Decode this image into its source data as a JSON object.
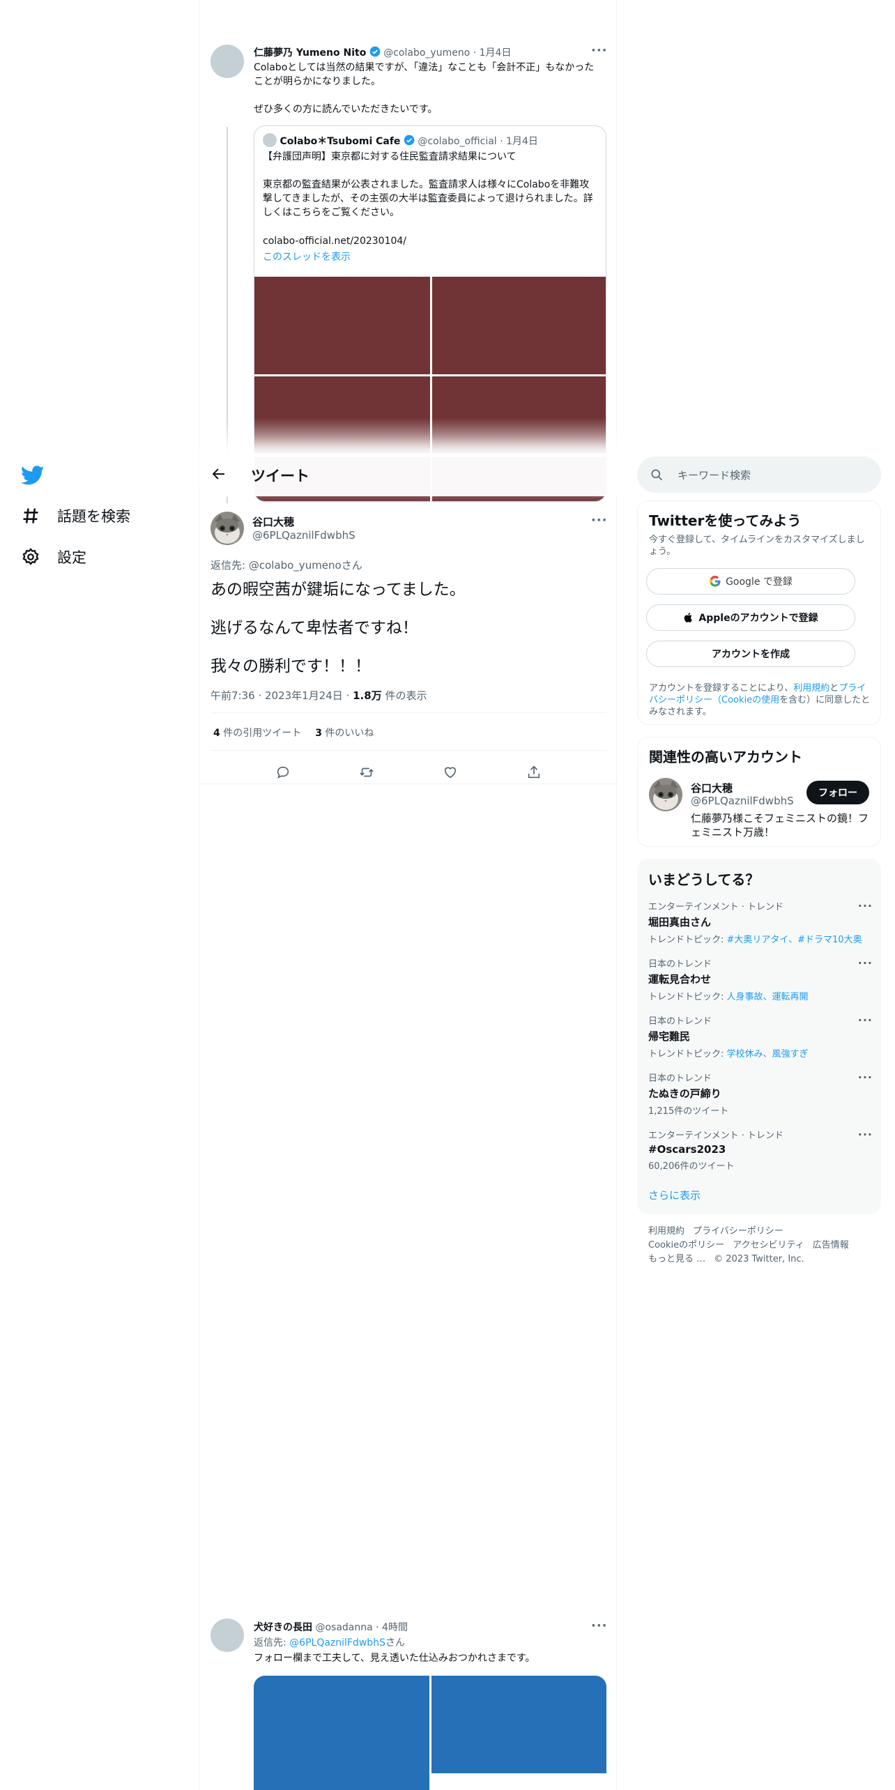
{
  "nav": {
    "items": [
      {
        "label": "話題を検索",
        "icon": "hashtag-icon"
      },
      {
        "label": "設定",
        "icon": "gear-icon"
      }
    ]
  },
  "parent_tweet": {
    "name": "仁藤夢乃 Yumeno Nito",
    "handle": "@colabo_yumeno",
    "time": "1月4日",
    "text1": "Colaboとしては当然の結果ですが、「違法」なことも「会計不正」もなかったことが明らかになりました。",
    "text2": "ぜひ多くの方に読んでいただきたいです。",
    "quote": {
      "name": "Colabo＊Tsubomi Cafe",
      "handle": "@colabo_official",
      "time": "1月4日",
      "line1": "【弁護団声明】東京都に対する住民監査請求結果について",
      "line2": "東京都の監査結果が公表されました。監査請求人は様々にColaboを非難攻撃してきましたが、その主張の大半は監査委員によって退けられました。詳しくはこちらをご覧ください。",
      "line3": "colabo-official.net/20230104/",
      "show_thread": "このスレッドを表示"
    }
  },
  "header": {
    "title": "ツイート"
  },
  "main_tweet": {
    "name": "谷口大穂",
    "handle": "@6PLQaznilFdwbhS",
    "reply_prefix": "返信先: ",
    "reply_handle": "@colabo_yumeno",
    "reply_suffix": "さん",
    "line1": "あの暇空茜が鍵垢になってました。",
    "line2": "逃げるなんて卑怯者ですね！",
    "line3": "我々の勝利です！！！",
    "time": "午前7:36",
    "date": "2023年1月24日",
    "views_count": "1.8万",
    "views_label": " 件の表示",
    "quotes_count": "4",
    "quotes_label": " 件の引用ツイート",
    "likes_count": "3",
    "likes_label": " 件のいいね"
  },
  "reply_tweet": {
    "name": "犬好きの長田",
    "handle": "@osadanna",
    "time": "4時間",
    "reply_prefix": "返信先: ",
    "reply_handle": "@6PLQaznilFdwbhS",
    "reply_suffix": "さん",
    "text": "フォロー欄まで工夫して、見え透いた仕込みおつかれさまです。"
  },
  "search": {
    "placeholder": "キーワード検索"
  },
  "signup": {
    "title": "Twitterを使ってみよう",
    "subtitle": "今すぐ登録して、タイムラインをカスタマイズしましょう。",
    "google": "Google で登録",
    "apple": "Appleのアカウントで登録",
    "create": "アカウントを作成",
    "legal_a": "アカウントを登録することにより、",
    "legal_terms": "利用規約",
    "legal_b": "と",
    "legal_privacy": "プライバシーポリシー（Cookieの使用",
    "legal_c": "を含む）に同意したとみなされます。"
  },
  "related": {
    "title": "関連性の高いアカウント",
    "name": "谷口大穂",
    "handle": "@6PLQaznilFdwbhS",
    "bio": "仁藤夢乃様こそフェミニストの鏡！フェミニスト万歳！",
    "follow": "フォロー"
  },
  "trends": {
    "title": "いまどうしてる？",
    "items": [
      {
        "category": "エンターテインメント · トレンド",
        "name": "堀田真由さん",
        "detail_prefix": "トレンドトピック: ",
        "detail_links": "#大奥リアタイ、#ドラマ10大奥"
      },
      {
        "category": "日本のトレンド",
        "name": "運転見合わせ",
        "detail_prefix": "トレンドトピック: ",
        "detail_links": "人身事故、運転再開"
      },
      {
        "category": "日本のトレンド",
        "name": "帰宅難民",
        "detail_prefix": "トレンドトピック: ",
        "detail_links": "学校休み、風強すぎ"
      },
      {
        "category": "日本のトレンド",
        "name": "たぬきの戸締り",
        "detail_prefix": "1,215件のツイート",
        "detail_links": ""
      },
      {
        "category": "エンターテインメント · トレンド",
        "name": "#Oscars2023",
        "detail_prefix": "60,206件のツイート",
        "detail_links": ""
      }
    ],
    "show_more": "さらに表示"
  },
  "footer": {
    "terms": "利用規約",
    "privacy": "プライバシーポリシー",
    "cookie": "Cookieのポリシー",
    "access": "アクセシビリティ",
    "ads": "広告情報",
    "more": "もっと見る …",
    "copyright": "© 2023 Twitter, Inc."
  },
  "colors": {
    "accent": "#1d9bf0",
    "quote_image": "#713436",
    "reply_image": "#2570b6"
  }
}
